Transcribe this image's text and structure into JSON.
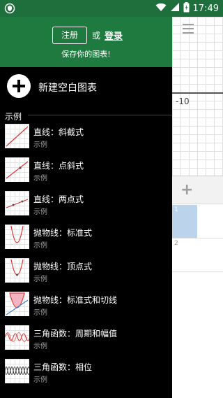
{
  "status_bar": {
    "time": "17:49"
  },
  "graph": {
    "tick_label": "-10",
    "expression_rows": [
      "1",
      "2"
    ]
  },
  "drawer": {
    "signup_label": "注册",
    "or_text": "或",
    "login_label": "登录",
    "save_text": "保存你的图表!",
    "new_graph_label": "新建空白图表",
    "examples_header": "示例",
    "examples": [
      {
        "title": "直线：斜截式",
        "subtitle": "示例"
      },
      {
        "title": "直线：点斜式",
        "subtitle": "示例"
      },
      {
        "title": "直线：两点式",
        "subtitle": "示例"
      },
      {
        "title": "抛物线：标准式",
        "subtitle": "示例"
      },
      {
        "title": "抛物线：顶点式",
        "subtitle": "示例"
      },
      {
        "title": "抛物线：标准式和切线",
        "subtitle": "示例"
      },
      {
        "title": "三角函数：周期和幅值",
        "subtitle": "示例"
      },
      {
        "title": "三角函数：相位",
        "subtitle": "示例"
      }
    ]
  },
  "colors": {
    "header_green": "#1e7a3f",
    "status_green": "#1e6f3b",
    "drawer_bg": "#000000",
    "selected_blue": "#bcd3ec"
  },
  "icons": [
    "shield-icon",
    "wifi-icon",
    "signal-icon",
    "battery-icon",
    "menu-icon",
    "add-icon",
    "plus-circle-icon"
  ]
}
